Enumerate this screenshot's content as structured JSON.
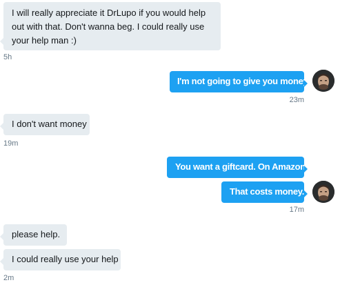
{
  "conversation": {
    "messages": [
      {
        "sender": "them",
        "text": "I will really appreciate it DrLupo if you would help out with that. Don't wanna beg. I could really use your help man :)"
      },
      {
        "sender": "them_time",
        "text": "5h"
      },
      {
        "sender": "me",
        "text": "I'm not going to give you money."
      },
      {
        "sender": "me_time",
        "text": "23m"
      },
      {
        "sender": "them",
        "text": "I don't want money"
      },
      {
        "sender": "them_time",
        "text": "19m"
      },
      {
        "sender": "me",
        "text": "You want a giftcard. On Amazon."
      },
      {
        "sender": "me",
        "text": "That costs money."
      },
      {
        "sender": "me_time",
        "text": "17m"
      },
      {
        "sender": "them",
        "text": "please help."
      },
      {
        "sender": "them",
        "text": "I could really use your help"
      },
      {
        "sender": "them_time",
        "text": "2m"
      }
    ]
  },
  "avatar": {
    "icon": "user-avatar-photo"
  },
  "colors": {
    "incoming_bubble": "#e6ecf0",
    "outgoing_bubble": "#1da1f2",
    "timestamp": "#657786"
  }
}
